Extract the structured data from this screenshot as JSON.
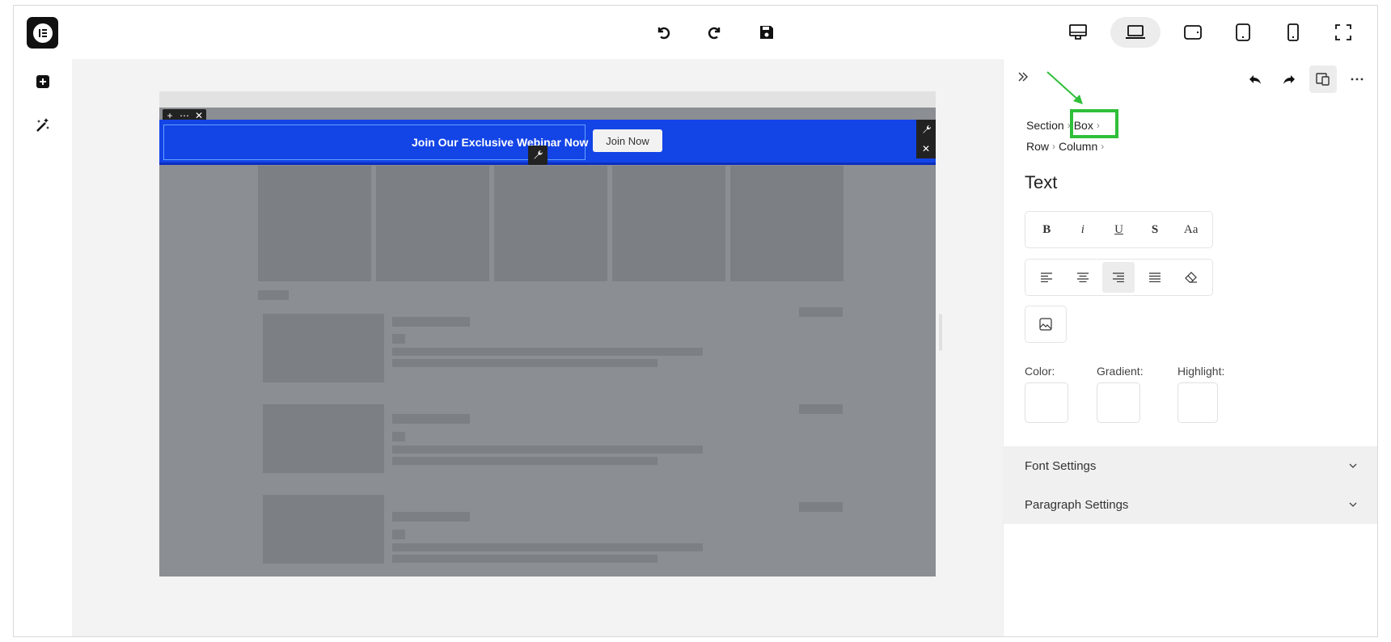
{
  "toolbar": {
    "undo": "undo-icon",
    "redo": "redo-icon",
    "save": "save-icon",
    "devices": [
      "desktop-icon",
      "laptop-icon",
      "tablet-landscape-icon",
      "tablet-icon",
      "mobile-icon",
      "fullscreen-icon"
    ],
    "active_device": "laptop"
  },
  "leftbar": {
    "items": [
      "add-icon",
      "magic-wand-icon"
    ]
  },
  "canvas": {
    "banner": {
      "text": "Join Our Exclusive Webinar Now",
      "button_label": "Join Now"
    },
    "section_tools": [
      "+",
      "⋯",
      "✕"
    ],
    "side_tools_close": "✕"
  },
  "panel": {
    "breadcrumbs_row1": [
      "Section",
      "Box"
    ],
    "breadcrumbs_row2": [
      "Row",
      "Column"
    ],
    "separator": "›",
    "title": "Text",
    "format_buttons": [
      "B",
      "i",
      "U",
      "S",
      "Aa"
    ],
    "align_buttons": [
      "align-left-icon",
      "align-center-icon",
      "align-right-icon",
      "align-justify-icon",
      "clear-format-icon"
    ],
    "active_align": "align-right",
    "color_labels": [
      "Color:",
      "Gradient:",
      "Highlight:"
    ],
    "accordions": [
      "Font Settings",
      "Paragraph Settings"
    ],
    "highlight_color": "#2fbf3a",
    "banner_color": "#1344e6"
  }
}
